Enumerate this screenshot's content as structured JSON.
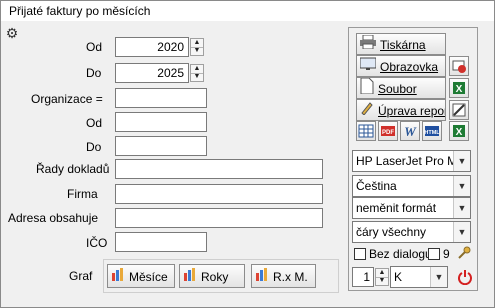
{
  "window": {
    "title": "Přijaté faktury po měsících"
  },
  "filters": {
    "od_label": "Od",
    "od_value": "2020",
    "do_label": "Do",
    "do_value": "2025",
    "organizace_label": "Organizace =",
    "organizace_value": "",
    "org_od_label": "Od",
    "org_od_value": "",
    "org_do_label": "Do",
    "org_do_value": "",
    "rady_label": "Řady dokladů",
    "rady_value": "",
    "firma_label": "Firma",
    "firma_value": "",
    "adresa_label": "Adresa obsahuje",
    "adresa_value": "",
    "ico_label": "IČO",
    "ico_value": ""
  },
  "graf": {
    "label": "Graf",
    "mesice": "Měsíce",
    "roky": "Roky",
    "rxm": "R.x M."
  },
  "output": {
    "tiskarna": "Tiskárna",
    "obrazovka": "Obrazovka",
    "soubor": "Soubor",
    "uprava": "Úprava repor",
    "printer": "HP LaserJet Pro MFP",
    "language": "Čeština",
    "format": "neměnit formát",
    "lines": "čáry všechny",
    "bez_dialogu": "Bez dialogu",
    "copies_count": "9",
    "copies": "1",
    "unit": "K"
  },
  "icons": {
    "gear": "gear-icon",
    "printer": "printer-icon",
    "screen": "monitor-icon",
    "file": "file-icon",
    "edit": "edit-report-icon",
    "power": "power-icon"
  },
  "colors": {
    "excel": "#1e7b34",
    "pdf": "#d0302b",
    "word": "#2b5797",
    "html": "#1f4fa0",
    "power": "#d42020"
  }
}
